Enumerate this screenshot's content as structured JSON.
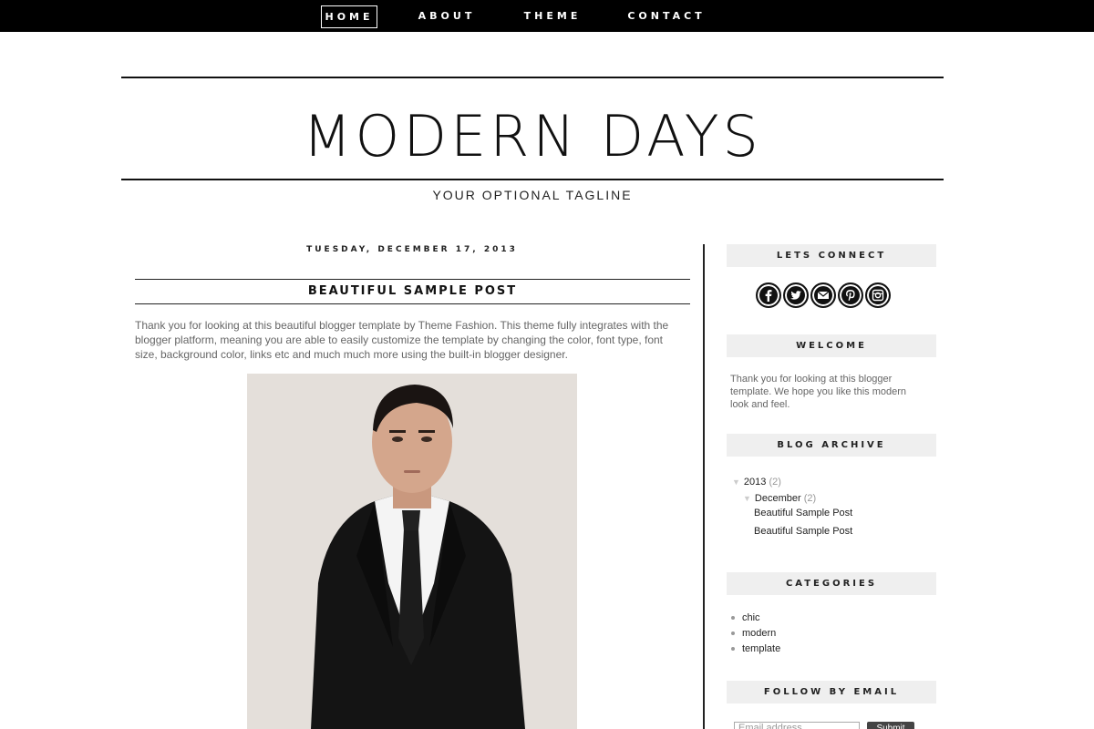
{
  "nav": {
    "items": [
      {
        "label": "HOME",
        "active": true
      },
      {
        "label": "ABOUT",
        "active": false
      },
      {
        "label": "THEME",
        "active": false
      },
      {
        "label": "CONTACT",
        "active": false
      }
    ]
  },
  "header": {
    "title": "MODERN DAYS",
    "tagline": "YOUR OPTIONAL TAGLINE"
  },
  "post": {
    "date": "TUESDAY, DECEMBER 17, 2013",
    "title": "BEAUTIFUL SAMPLE POST",
    "body": "Thank you for looking at this beautiful blogger template by Theme Fashion. This theme fully integrates with the blogger platform, meaning you are able to easily customize the template by changing the color, font type, font size, background color, links etc and much much more using the built-in blogger designer."
  },
  "sidebar": {
    "connect": {
      "heading": "LETS CONNECT",
      "icons": [
        "facebook-icon",
        "twitter-icon",
        "email-icon",
        "pinterest-icon",
        "instagram-icon"
      ]
    },
    "welcome": {
      "heading": "WELCOME",
      "text": "Thank you for looking at this blogger template. We hope you like this modern look and feel."
    },
    "archive": {
      "heading": "BLOG ARCHIVE",
      "year": "2013",
      "year_count": "(2)",
      "month": "December",
      "month_count": "(2)",
      "posts": [
        "Beautiful Sample Post",
        "Beautiful Sample Post"
      ]
    },
    "categories": {
      "heading": "CATEGORIES",
      "items": [
        "chic",
        "modern",
        "template"
      ]
    },
    "follow": {
      "heading": "FOLLOW BY EMAIL",
      "placeholder": "Email address...",
      "submit_label": "Submit"
    }
  },
  "colors": {
    "nav_bg": "#000000",
    "widget_bg": "#efefef",
    "text_muted": "#666666"
  }
}
